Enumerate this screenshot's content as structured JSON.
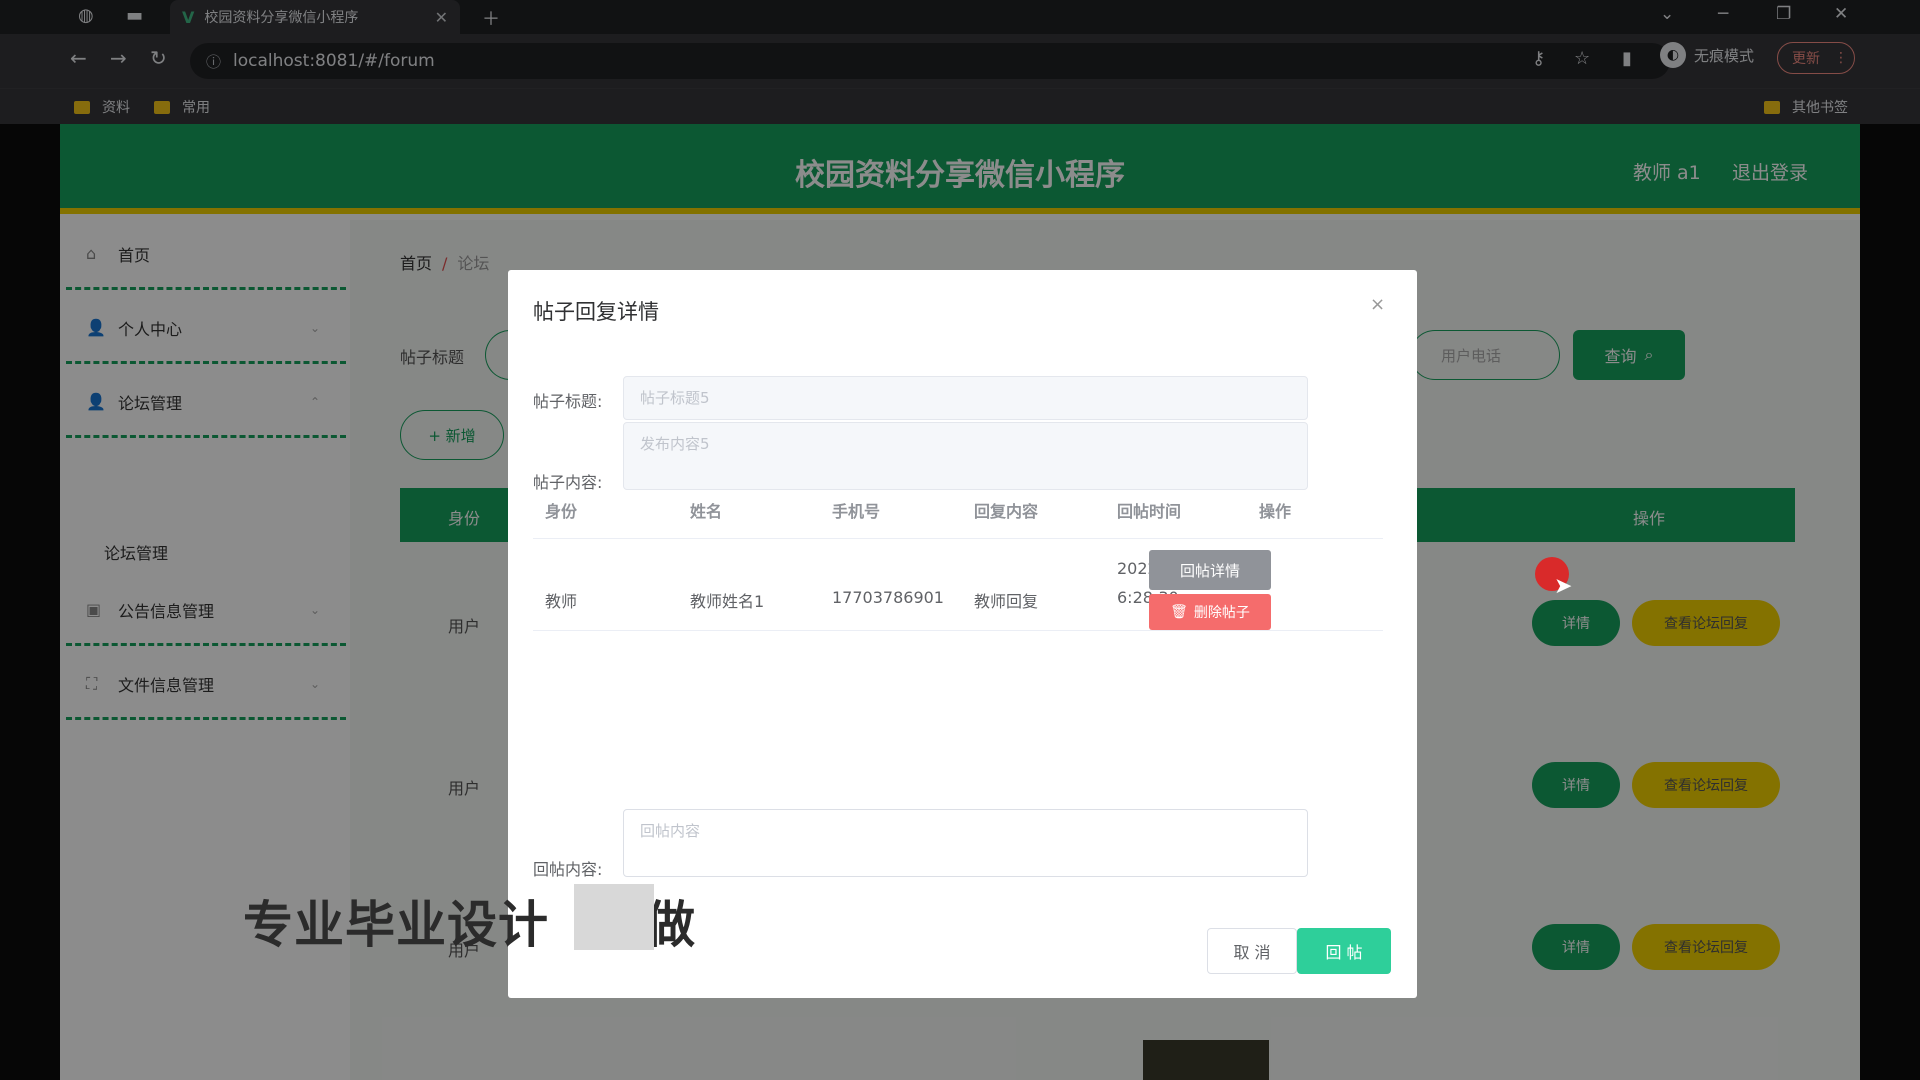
{
  "browser": {
    "tab_title": "校园资料分享微信小程序",
    "tab_logo": "V",
    "url": "localhost:8081/#/forum",
    "incognito_label": "无痕模式",
    "update_label": "更新",
    "bookmarks": [
      "资料",
      "常用"
    ],
    "other_bookmarks": "其他书签"
  },
  "header": {
    "title": "校园资料分享微信小程序",
    "user": "教师 a1",
    "logout": "退出登录"
  },
  "sidebar": {
    "items": [
      {
        "label": "首页",
        "icon": "home-icon"
      },
      {
        "label": "个人中心",
        "icon": "user-icon"
      },
      {
        "label": "论坛管理",
        "icon": "user-icon"
      },
      {
        "label": "公告信息管理",
        "icon": "briefcase-icon"
      },
      {
        "label": "文件信息管理",
        "icon": "expand-icon"
      }
    ],
    "sub_item": "论坛管理"
  },
  "main": {
    "breadcrumb_home": "首页",
    "breadcrumb_current": "论坛",
    "search_label": "帖子标题",
    "phone_placeholder": "用户电话",
    "query_button": "查询",
    "add_button": "+ 新增",
    "table_headers": {
      "identity": "身份",
      "actions": "操作"
    },
    "rows": [
      {
        "identity": "用户",
        "detail": "详情",
        "view_replies": "查看论坛回复"
      },
      {
        "identity": "用户",
        "detail": "详情",
        "view_replies": "查看论坛回复"
      },
      {
        "identity": "用户",
        "detail": "详情",
        "view_replies": "查看论坛回复"
      }
    ]
  },
  "dialog": {
    "title": "帖子回复详情",
    "close_icon": "×",
    "post_title_label": "帖子标题:",
    "post_title_value": "帖子标题5",
    "post_content_label": "帖子内容:",
    "post_content_value": "发布内容5",
    "table": {
      "headers": [
        "身份",
        "姓名",
        "手机号",
        "回复内容",
        "回帖时间",
        "操作"
      ],
      "rows": [
        {
          "identity": "教师",
          "name": "教师姓名1",
          "phone": "17703786901",
          "content": "教师回复",
          "time_line1": "2022-03-23 1",
          "time_line2": "6:28:30",
          "btn_detail": "回帖详情",
          "btn_delete": "删除帖子"
        }
      ]
    },
    "reply_label": "回帖内容:",
    "reply_placeholder": "回帖内容",
    "cancel": "取 消",
    "submit": "回 帖"
  },
  "overlay_text": "专业毕业设计",
  "overlay_text_tail": "做"
}
